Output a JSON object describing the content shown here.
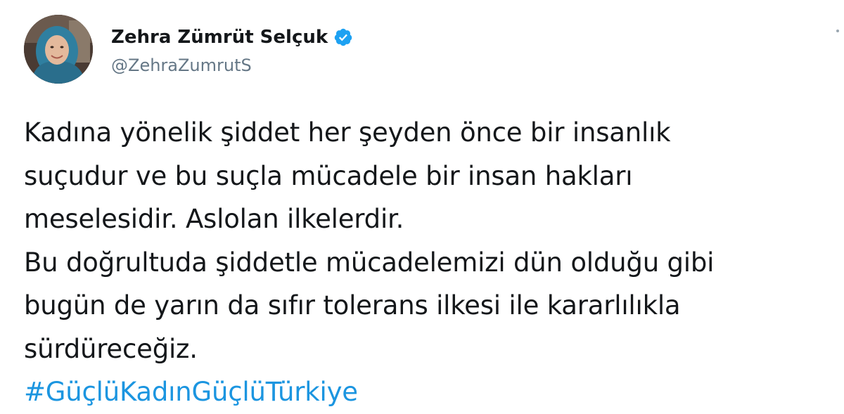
{
  "tweet": {
    "author": {
      "display_name": "Zehra Zümrüt Selçuk",
      "handle": "@ZehraZumrutS",
      "verified": true,
      "avatar_icon": "profile-photo"
    },
    "text_lines": [
      "Kadına yönelik şiddet her şeyden önce bir insanlık",
      "suçudur ve bu suçla mücadele bir insan hakları",
      "meselesidir. Aslolan ilkelerdir.",
      "Bu doğrultuda şiddetle mücadelemizi dün olduğu gibi",
      "bugün de yarın da sıfır tolerans ilkesi ile kararlılıkla",
      "sürdüreceğiz."
    ],
    "hashtag": "#GüçlüKadınGüçlüTürkiye"
  },
  "colors": {
    "text": "#14171a",
    "secondary_text": "#657786",
    "link": "#1b95e0",
    "verified_badge": "#1da1f2"
  },
  "icons": {
    "verified": "verified-badge-icon",
    "more": "more-options-icon"
  }
}
